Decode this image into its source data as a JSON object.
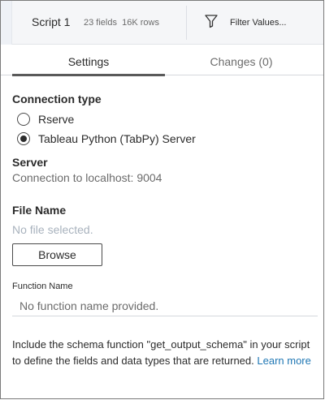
{
  "step": {
    "name": "Script 1",
    "fields": "23 fields",
    "rows": "16K rows"
  },
  "toolbar": {
    "filter_label": "Filter Values..."
  },
  "tabs": [
    {
      "label": "Settings",
      "active": true
    },
    {
      "label": "Changes (0)",
      "active": false
    }
  ],
  "connection": {
    "heading": "Connection type",
    "options": [
      {
        "label": "Rserve",
        "selected": false
      },
      {
        "label": "Tableau Python (TabPy) Server",
        "selected": true
      }
    ]
  },
  "server": {
    "heading": "Server",
    "value": "Connection to localhost: 9004"
  },
  "file": {
    "heading": "File Name",
    "placeholder": "No file selected.",
    "browse_label": "Browse"
  },
  "function": {
    "label": "Function Name",
    "placeholder": "No function name provided."
  },
  "help": {
    "text": "Include the schema function \"get_output_schema\" in your script to define the fields and data types that are returned.",
    "link": "Learn more"
  },
  "colors": {
    "link": "#1f77b4",
    "placeholder": "#a8b2bd",
    "tab_underline": "#5a5a5a"
  }
}
